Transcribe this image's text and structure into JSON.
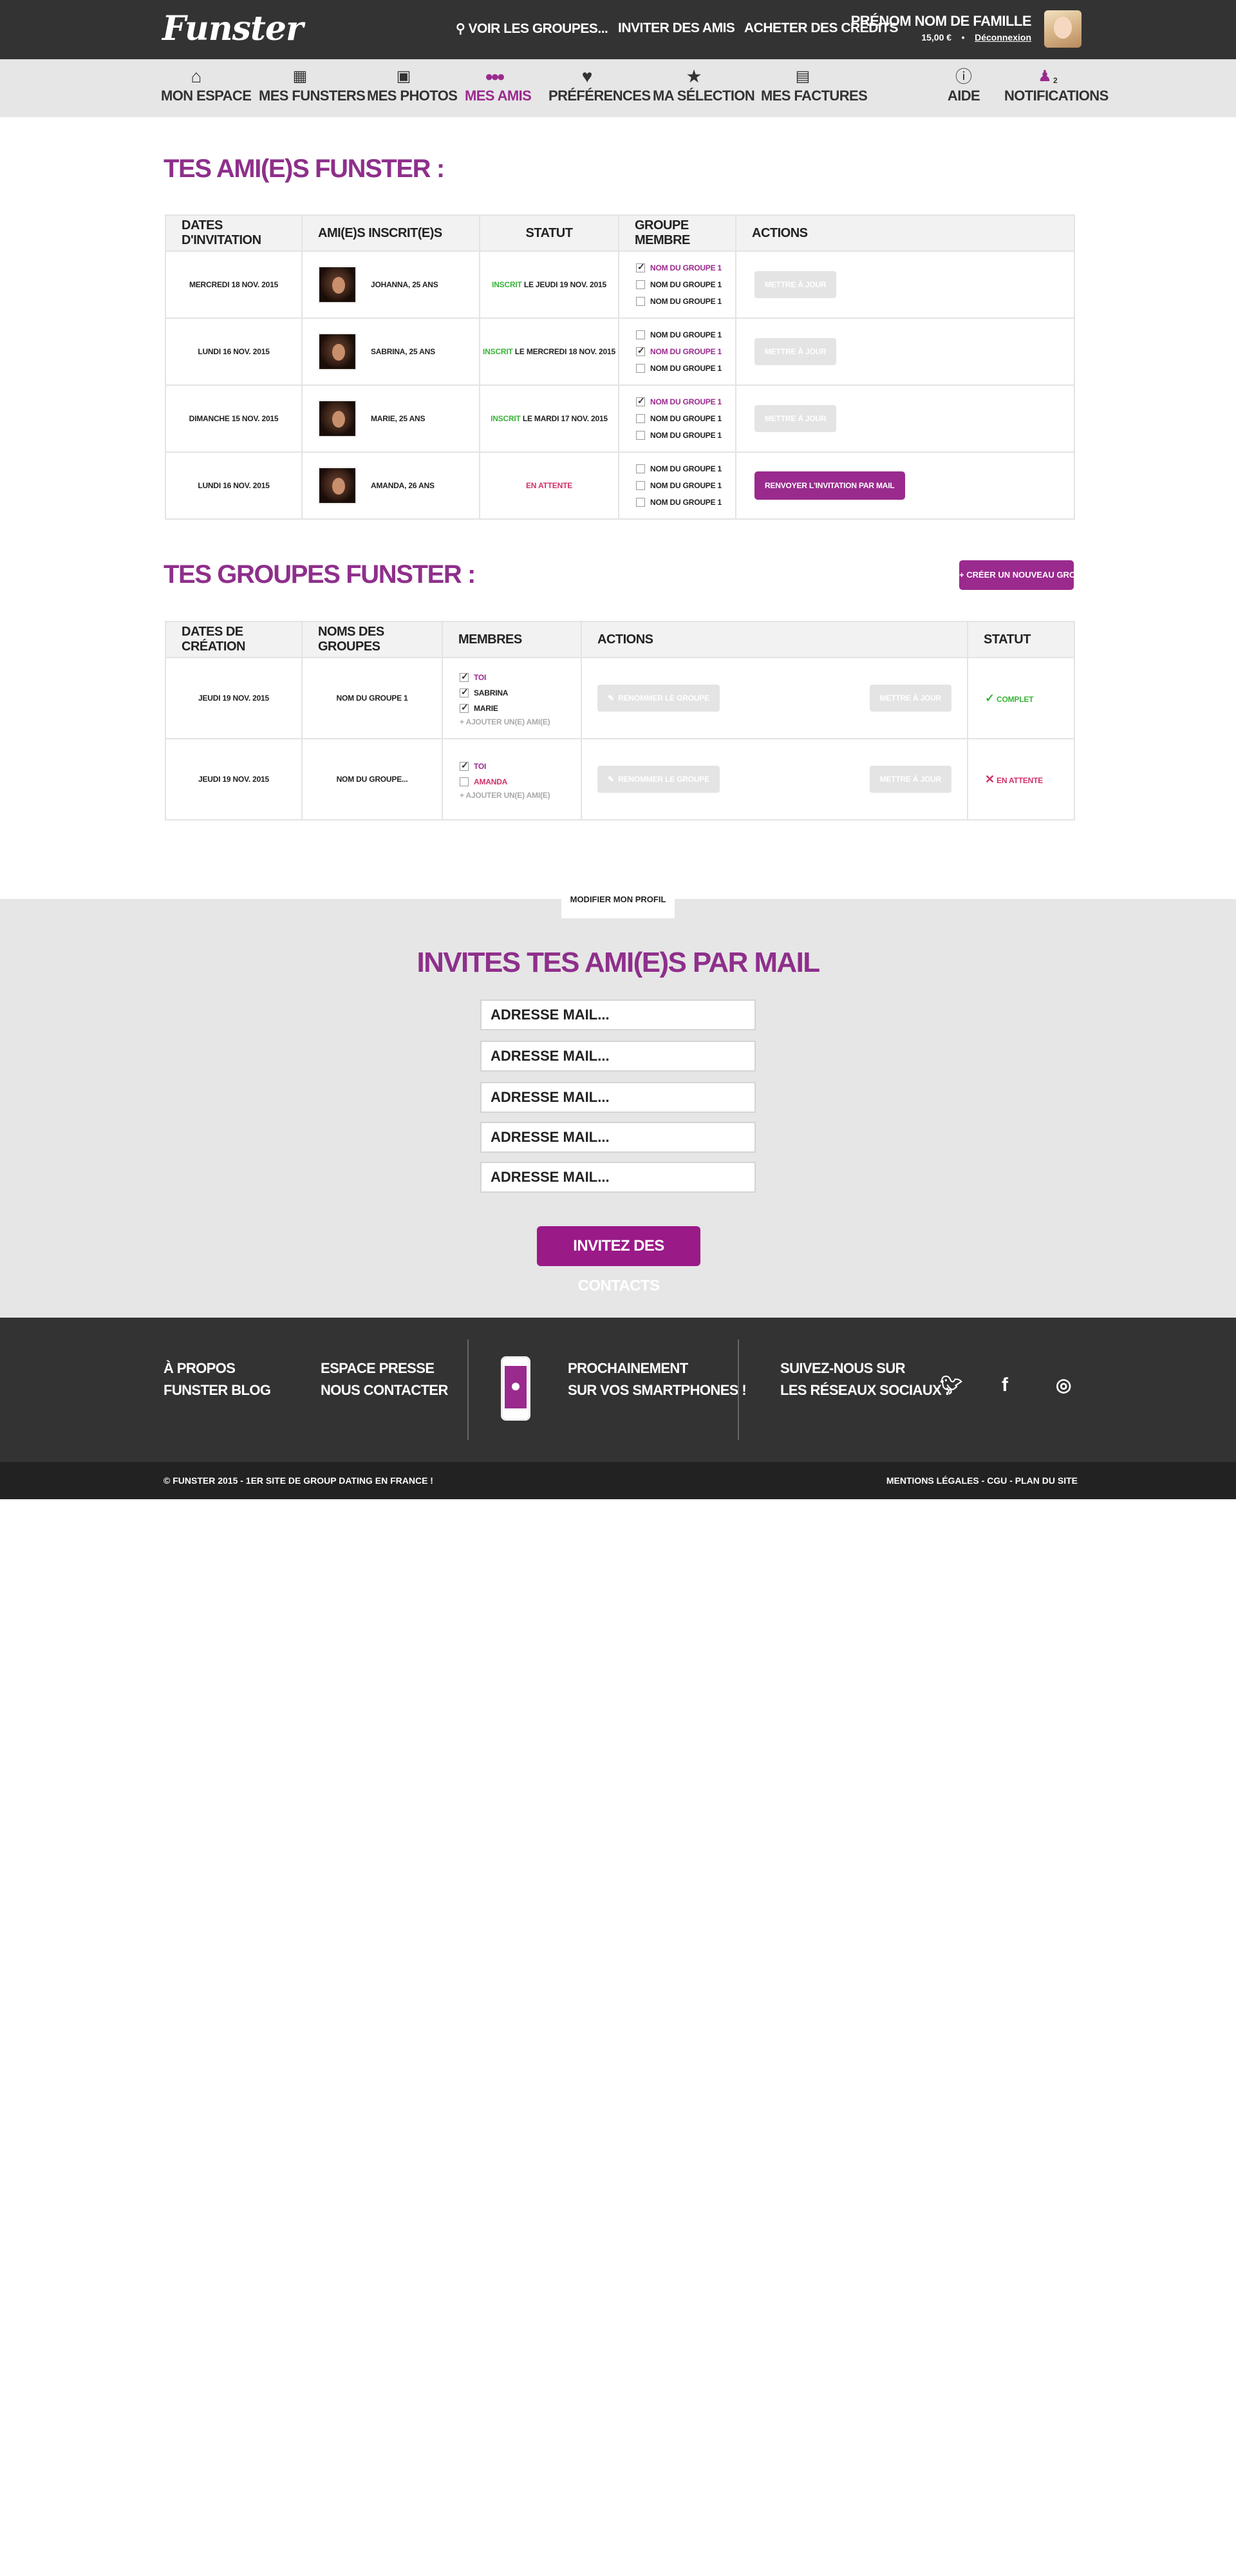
{
  "header": {
    "logo": "Funster",
    "links": [
      {
        "label": "Voir les groupes...",
        "icon": "search-icon"
      },
      {
        "label": "Inviter des amis"
      },
      {
        "label": "Acheter des crédits"
      }
    ],
    "user_name": "Prénom Nom de famille",
    "credits": "15,00 €",
    "separator": "•",
    "logout": "Déconnexion"
  },
  "nav": {
    "items": [
      {
        "label": "Mon espace",
        "icon": "home-icon"
      },
      {
        "label": "Mes Funsters",
        "icon": "calendar-icon"
      },
      {
        "label": "Mes photos",
        "icon": "photos-icon"
      },
      {
        "label": "Mes amis",
        "icon": "friends-icon",
        "active": true
      },
      {
        "label": "Préférences",
        "icon": "heart-icon"
      },
      {
        "label": "Ma sélection",
        "icon": "star-icon"
      },
      {
        "label": "Mes factures",
        "icon": "invoice-icon"
      },
      {
        "label": "Aide",
        "icon": "info-icon"
      },
      {
        "label": "Notifications",
        "icon": "bell-icon",
        "badge": "2"
      }
    ],
    "active_color": "#9a2a8e"
  },
  "friends": {
    "title": "Tes ami(e)s Funster :",
    "columns": [
      "Dates d'invitation",
      "Ami(e)s inscrit(e)s",
      "Statut",
      "Groupe membre",
      "Actions"
    ],
    "rows": [
      {
        "date": "Mercredi 18 nov. 2015",
        "friend": "Johanna, 25 ans",
        "status_a": "Inscrit",
        "status_b": "le jeudi 19 nov. 2015",
        "groups": [
          "Nom du groupe 1",
          "Nom du groupe 1",
          "Nom du groupe 1"
        ],
        "action": "Mettre à jour"
      },
      {
        "date": "Lundi 16 nov. 2015",
        "friend": "Sabrina, 25 ans",
        "status_a": "Inscrit",
        "status_b": "le mercredi 18 nov. 2015",
        "groups": [
          "Nom du groupe 1",
          "Nom du groupe 1",
          "Nom du groupe 1"
        ],
        "action": "Mettre à jour"
      },
      {
        "date": "Dimanche 15 nov. 2015",
        "friend": "Marie, 25 ans",
        "status_a": "Inscrit",
        "status_b": "le mardi 17 nov. 2015",
        "groups": [
          "Nom du groupe 1",
          "Nom du groupe 1",
          "Nom du groupe 1"
        ],
        "action": "Mettre à jour"
      },
      {
        "date": "Lundi 16 nov. 2015",
        "friend": "Amanda, 26 ans",
        "status_a": "En attente",
        "status_b": "",
        "groups": [
          "Nom du groupe 1",
          "Nom du groupe 1",
          "Nom du groupe 1"
        ],
        "action": "Renvoyer l'invitation par mail"
      }
    ]
  },
  "groups": {
    "title": "Tes groupes Funster :",
    "create_button": "+ Créer un nouveau groupe",
    "columns": [
      "Dates de création",
      "Noms des groupes",
      "Membres",
      "Actions",
      "Statut"
    ],
    "rows": [
      {
        "date": "Jeudi 19 nov. 2015",
        "name": "Nom du groupe 1",
        "members": [
          "Toi",
          "Sabrina",
          "Marie"
        ],
        "add": "+ Ajouter un(e) ami(e)",
        "rename": "Renommer le groupe",
        "update": "Mettre à jour",
        "status": "Complet"
      },
      {
        "date": "Jeudi 19 nov. 2015",
        "name": "Nom du groupe...",
        "members": [
          "Toi",
          "Amanda"
        ],
        "add": "+ Ajouter un(e) ami(e)",
        "rename": "Renommer le groupe",
        "update": "Mettre à jour",
        "status": "En attente"
      }
    ]
  },
  "invite": {
    "profile_tab": "Modifier mon profil",
    "title": "Invites tes ami(e)s par mail",
    "placeholder": "Adresse mail...",
    "button": "Invitez des contacts"
  },
  "footer": {
    "col1": [
      "À propos",
      "Funster blog"
    ],
    "col2": [
      "Espace presse",
      "Nous contacter"
    ],
    "app_line1": "Prochainement",
    "app_line2": "sur vos smartphones !",
    "social_line1": "Suivez-nous sur",
    "social_line2": "les réseaux sociaux :",
    "social_icons": [
      "twitter-icon",
      "facebook-icon",
      "instagram-icon"
    ]
  },
  "bottom": {
    "copyright": "© Funster 2015 - 1er site de group dating en France !",
    "legal": "Mentions légales - CGU - Plan du site"
  }
}
